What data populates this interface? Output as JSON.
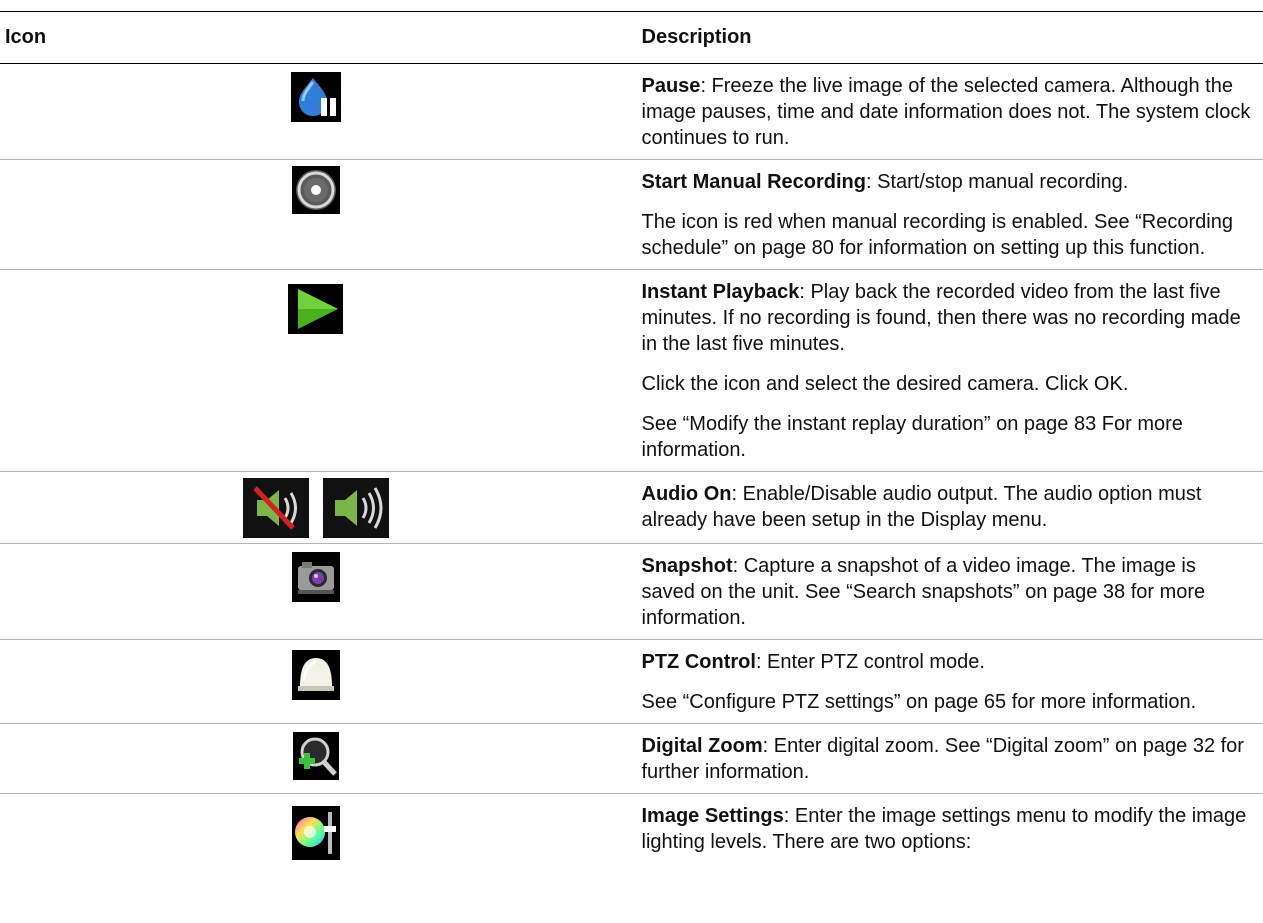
{
  "table": {
    "header": {
      "icon": "Icon",
      "description": "Description"
    },
    "rows": [
      {
        "icon": "pause-icon",
        "title": "Pause",
        "paragraphs": [
          ": Freeze the live image of the selected camera. Although the image pauses, time and date information does not. The system clock continues to run."
        ]
      },
      {
        "icon": "manual-recording-icon",
        "title": "Start Manual Recording",
        "paragraphs": [
          ": Start/stop manual recording.",
          "The icon is red when manual recording is enabled. See “Recording schedule” on page 80 for information on setting up this function."
        ]
      },
      {
        "icon": "play-icon",
        "title": "Instant Playback",
        "paragraphs": [
          ": Play back the recorded video from the last five minutes. If no recording is found, then there was no recording made in the last five minutes.",
          "Click the icon and select the desired camera. Click OK.",
          "See “Modify the instant replay duration” on page 83 For more information."
        ]
      },
      {
        "icon": "audio-icons",
        "icons": [
          "audio-off-icon",
          "audio-on-icon"
        ],
        "title": "Audio On",
        "paragraphs": [
          ": Enable/Disable audio output. The audio option must already have been setup in the Display menu."
        ]
      },
      {
        "icon": "camera-icon",
        "title": "Snapshot",
        "paragraphs": [
          ": Capture a snapshot of a video image. The image is saved on the unit. See “Search snapshots” on page 38 for more information."
        ]
      },
      {
        "icon": "ptz-dome-icon",
        "title": "PTZ Control",
        "paragraphs": [
          ": Enter PTZ control mode.",
          "See “Configure PTZ settings” on page 65 for more information."
        ]
      },
      {
        "icon": "zoom-icon",
        "title": "Digital Zoom",
        "paragraphs": [
          ": Enter digital zoom. See “Digital zoom” on page 32 for further information."
        ]
      },
      {
        "icon": "image-settings-icon",
        "title": "Image Settings",
        "paragraphs": [
          ": Enter the image settings menu to modify the image lighting levels. There are two options:"
        ]
      }
    ]
  }
}
